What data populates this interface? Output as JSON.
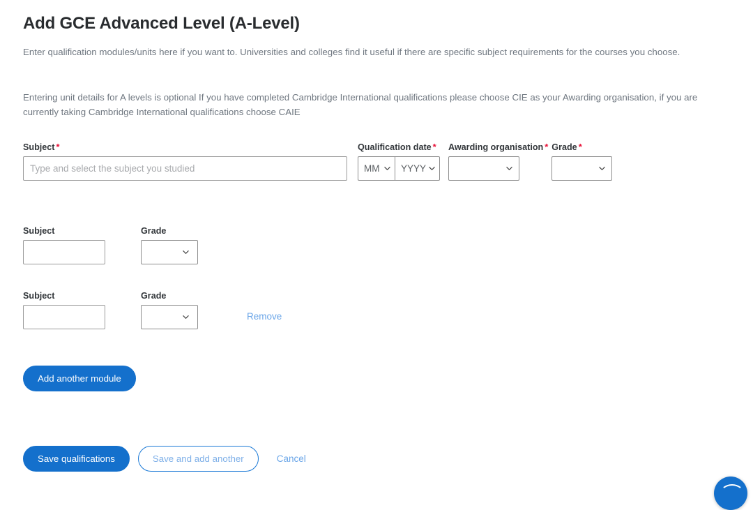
{
  "page": {
    "title": "Add GCE Advanced Level (A-Level)",
    "intro_1": "Enter qualification modules/units here if you want to. Universities and colleges find it useful if there are specific subject requirements for the courses you choose.",
    "intro_2": "Entering unit details for A levels is optional If you have completed Cambridge International qualifications please choose CIE as your Awarding organisation, if you are currently taking Cambridge International qualifications choose CAIE"
  },
  "qualification": {
    "subject": {
      "label": "Subject",
      "required_mark": "*",
      "value": "",
      "placeholder": "Type and select the subject you studied"
    },
    "qualification_date": {
      "label": "Qualification date",
      "required_mark": "*",
      "month": {
        "value": "MM"
      },
      "year": {
        "value": "YYYY"
      }
    },
    "awarding_organisation": {
      "label": "Awarding organisation",
      "required_mark": "*",
      "value": ""
    },
    "grade": {
      "label": "Grade",
      "required_mark": "*",
      "value": ""
    }
  },
  "modules": [
    {
      "subject_label": "Subject",
      "subject_value": "",
      "grade_label": "Grade",
      "grade_value": "",
      "remove_label": ""
    },
    {
      "subject_label": "Subject",
      "subject_value": "",
      "grade_label": "Grade",
      "grade_value": "",
      "remove_label": "Remove"
    }
  ],
  "buttons": {
    "add_another_module": "Add another module",
    "save_qualifications": "Save qualifications",
    "save_and_add_another": "Save and add another",
    "cancel": "Cancel"
  },
  "colors": {
    "primary_blue": "#1470cc",
    "link_blue": "#6ba6e8",
    "required_red": "#e8143a",
    "heading": "#292c2f",
    "body_text": "#6f7780"
  },
  "icons": {
    "chevron": "chevron-down-icon",
    "chat": "chat-bubble-icon"
  }
}
